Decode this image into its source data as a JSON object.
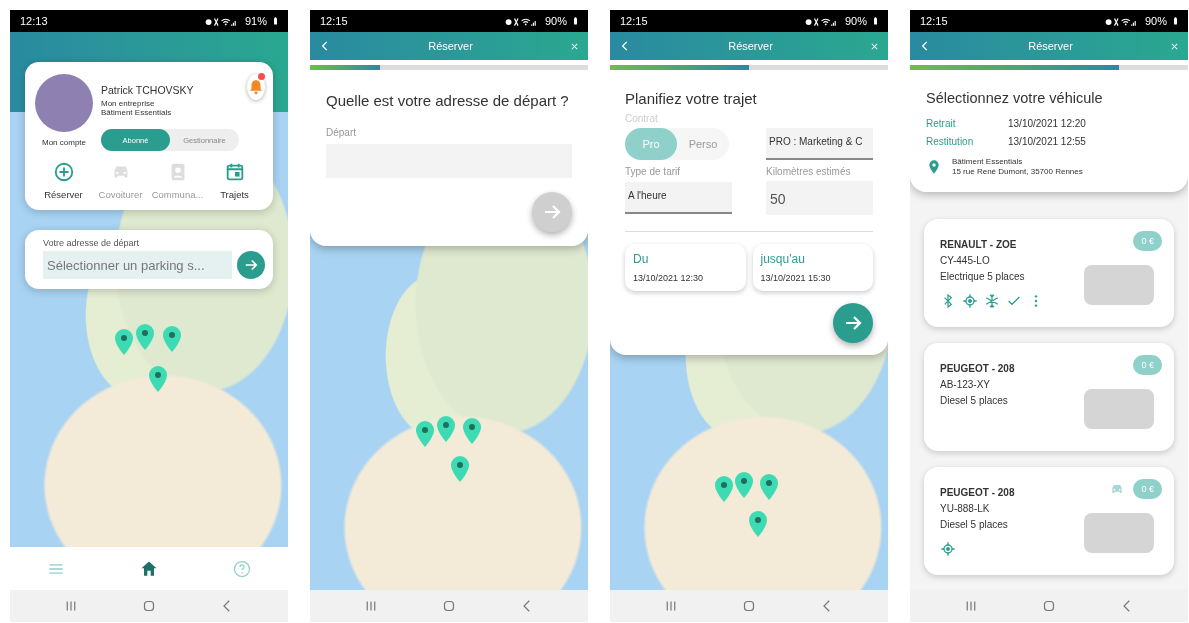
{
  "screens": [
    {
      "kind": "home",
      "status": {
        "time": "12:13",
        "battery": "91%"
      },
      "profile": {
        "name": "Patrick TCHOVSKY",
        "company_label": "Mon entreprise",
        "company": "Bâtiment Essentials",
        "account_label": "Mon compte",
        "notification": true
      },
      "role_toggle": [
        {
          "label": "Abonné",
          "selected": true
        },
        {
          "label": "Gestionnaire",
          "selected": false
        }
      ],
      "actions": [
        {
          "kind": "plus",
          "label": "Réserver",
          "disabled": false
        },
        {
          "kind": "car",
          "label": "Covoiturer",
          "disabled": true
        },
        {
          "kind": "contact",
          "label": "Communa...",
          "disabled": true
        },
        {
          "kind": "calendar",
          "label": "Trajets",
          "disabled": false
        }
      ],
      "address": {
        "label": "Votre adresse de départ",
        "placeholder": "Sélectionner un parking s..."
      },
      "tab_bar": [
        {
          "kind": "menu",
          "selected": false
        },
        {
          "kind": "home",
          "selected": true
        },
        {
          "kind": "help",
          "selected": false
        }
      ]
    },
    {
      "kind": "address",
      "status": {
        "time": "12:15",
        "battery": "90%"
      },
      "header": {
        "title": "Réserver"
      },
      "progress": {
        "level": 0.25
      },
      "question": "Quelle est votre adresse de départ ?",
      "field": {
        "label": "Départ"
      },
      "next": {
        "disabled": true
      }
    },
    {
      "kind": "plan",
      "status": {
        "time": "12:15",
        "battery": "90%"
      },
      "header": {
        "title": "Réserver"
      },
      "progress": {
        "level": 0.5
      },
      "title": "Planifiez votre trajet",
      "contract": {
        "label": "Contrat",
        "options": [
          {
            "label": "Pro",
            "selected": true
          },
          {
            "label": "Perso",
            "selected": false
          }
        ],
        "value": "PRO : Marketing & C"
      },
      "rate": {
        "label": "Type de tarif",
        "value": "A l'heure"
      },
      "distance": {
        "label": "Kilomètres estimés",
        "value": "50"
      },
      "dates": [
        {
          "label": "Du",
          "value": "13/10/2021 12:30"
        },
        {
          "label": "jusqu'au",
          "value": "13/10/2021 15:30"
        }
      ],
      "next": {
        "disabled": false
      }
    },
    {
      "kind": "vehicles",
      "status": {
        "time": "12:15",
        "battery": "90%"
      },
      "header": {
        "title": "Réserver"
      },
      "progress": {
        "level": 0.75
      },
      "title": "Sélectionnez votre véhicule",
      "schedule": [
        {
          "label": "Retrait",
          "value": "13/10/2021 12:20"
        },
        {
          "label": "Restitution",
          "value": "13/10/2021 12:55"
        }
      ],
      "location": {
        "name": "Bâtiment Essentials",
        "address": "15 rue René Dumont, 35700 Rennes"
      },
      "vehicles": [
        {
          "name": "RENAULT - ZOE",
          "plate": "CY-445-LO",
          "description": "Electrique 5 places",
          "price": "0 €",
          "shared": false,
          "features": [
            {
              "kind": "bluetooth"
            },
            {
              "kind": "gps"
            },
            {
              "kind": "climate"
            },
            {
              "kind": "check"
            },
            {
              "kind": "more"
            }
          ]
        },
        {
          "name": "PEUGEOT - 208",
          "plate": "AB-123-XY",
          "description": "Diesel 5 places",
          "price": "0 €",
          "shared": false
        },
        {
          "name": "PEUGEOT - 208",
          "plate": "YU-888-LK",
          "description": "Diesel 5 places",
          "price": "0 €",
          "shared": true,
          "features": [
            {
              "kind": "gps"
            }
          ]
        }
      ]
    }
  ]
}
